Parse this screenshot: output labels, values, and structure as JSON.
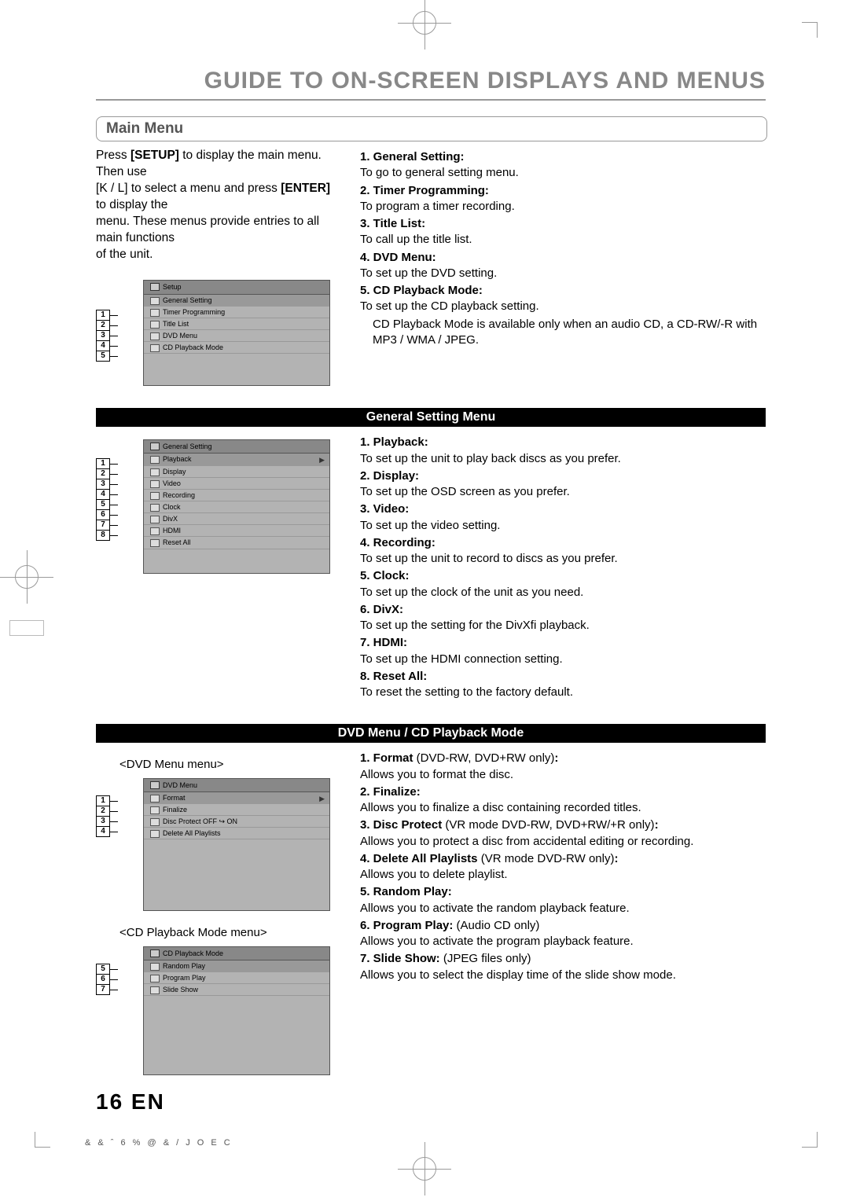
{
  "page_title": "GUIDE TO ON-SCREEN DISPLAYS AND MENUS",
  "section_main": "Main Menu",
  "intro": {
    "l1a": "Press ",
    "l1b": "[SETUP]",
    "l1c": " to display the main menu. Then use",
    "l2a": "[",
    "l2b": "K",
    "l2c": " / ",
    "l2d": "L",
    "l2e": "] to select a menu and press ",
    "l2f": "[ENTER]",
    "l2g": " to display the",
    "l3": "menu. These menus provide entries to all main functions",
    "l4": "of the unit."
  },
  "setup_menu": {
    "title": "Setup",
    "rows": [
      "General Setting",
      "Timer Programming",
      "Title List",
      "DVD Menu",
      "CD Playback Mode"
    ],
    "nums": [
      "1",
      "2",
      "3",
      "4",
      "5"
    ]
  },
  "main_items": [
    {
      "t": "1. General Setting:",
      "d": "To go to general setting menu."
    },
    {
      "t": "2. Timer Programming:",
      "d": "To program a timer recording."
    },
    {
      "t": "3. Title List:",
      "d": "To call up the title list."
    },
    {
      "t": "4. DVD Menu:",
      "d": "To set up the DVD setting."
    },
    {
      "t": "5. CD Playback Mode:",
      "d": "To set up the CD playback setting.",
      "note": "CD Playback Mode is available only when an audio CD, a CD-RW/-R with MP3 / WMA / JPEG."
    }
  ],
  "sub_general": "General Setting Menu",
  "general_menu": {
    "title": "General Setting",
    "rows": [
      "Playback",
      "Display",
      "Video",
      "Recording",
      "Clock",
      "DivX",
      "HDMI",
      "Reset All"
    ],
    "nums": [
      "1",
      "2",
      "3",
      "4",
      "5",
      "6",
      "7",
      "8"
    ]
  },
  "general_items": [
    {
      "t": "1. Playback:",
      "d": "To set up the unit to play back discs as you prefer."
    },
    {
      "t": "2. Display:",
      "d": "To set up the OSD screen as you prefer."
    },
    {
      "t": "3. Video:",
      "d": "To set up the video setting."
    },
    {
      "t": "4. Recording:",
      "d": "To set up the unit to record to discs as you prefer."
    },
    {
      "t": "5. Clock:",
      "d": "To set up the clock of the unit as you need."
    },
    {
      "t": "6. DivX:",
      "d": "To set up the setting for the DivXfi playback."
    },
    {
      "t": "7. HDMI:",
      "d": "To set up the HDMI connection setting."
    },
    {
      "t": "8. Reset All:",
      "d": "To reset the setting to the factory default."
    }
  ],
  "sub_dvd": "DVD Menu / CD Playback Mode",
  "caption_dvd": "<DVD Menu menu>",
  "dvd_menu": {
    "title": "DVD Menu",
    "rows": [
      "Format",
      "Finalize",
      "Disc Protect OFF ↪ ON",
      "Delete All Playlists"
    ],
    "nums": [
      "1",
      "2",
      "3",
      "4"
    ]
  },
  "caption_cd": "<CD Playback Mode menu>",
  "cd_menu": {
    "title": "CD Playback Mode",
    "rows": [
      "Random Play",
      "Program Play",
      "Slide Show"
    ],
    "nums": [
      "5",
      "6",
      "7"
    ]
  },
  "dvd_items": [
    {
      "t": "1. Format",
      "q": " (DVD-RW, DVD+RW only)",
      "c": ":",
      "d": "Allows you to format the disc."
    },
    {
      "t": "2. Finalize:",
      "d": "Allows you to finalize a disc containing recorded titles."
    },
    {
      "t": "3. Disc Protect",
      "q": " (VR mode DVD-RW, DVD+RW/+R only)",
      "c": ":",
      "d": "Allows you to protect a disc from accidental editing or recording."
    },
    {
      "t": "4. Delete All Playlists",
      "q": " (VR mode DVD-RW only)",
      "c": ":",
      "d": "Allows you to delete playlist."
    },
    {
      "t": "5. Random Play:",
      "d": "Allows you to activate the random playback feature."
    },
    {
      "t": "6. Program Play:",
      "q": " (Audio CD only)",
      "d": "Allows you to activate the program playback feature."
    },
    {
      "t": "7. Slide Show:",
      "q": " (JPEG files only)",
      "d": "Allows you to select the display time of the slide show mode."
    }
  ],
  "page_num": "16  EN",
  "footer": "& & ˆ 6 % @ & / J O E C"
}
